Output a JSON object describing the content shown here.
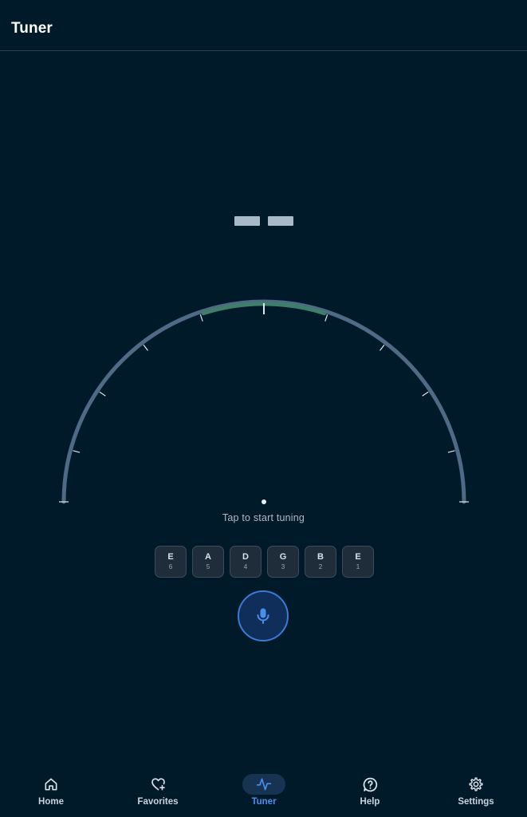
{
  "header": {
    "title": "Tuner"
  },
  "tuner": {
    "note_placeholder": "-- --",
    "status_text": "Tap to start tuning",
    "in_tune_color": "#3f7f6a",
    "arc_color": "#4e6a85",
    "needle_color": "#e8eef4"
  },
  "strings": [
    {
      "note": "E",
      "number": "6"
    },
    {
      "note": "A",
      "number": "5"
    },
    {
      "note": "D",
      "number": "4"
    },
    {
      "note": "G",
      "number": "3"
    },
    {
      "note": "B",
      "number": "2"
    },
    {
      "note": "E",
      "number": "1"
    }
  ],
  "mic_button": {
    "icon": "microphone-icon",
    "accent": "#3b7bd6"
  },
  "bottom_nav": {
    "active": "Tuner",
    "items": [
      {
        "label": "Home",
        "icon": "home-icon"
      },
      {
        "label": "Favorites",
        "icon": "heart-plus-icon"
      },
      {
        "label": "Tuner",
        "icon": "waveform-icon"
      },
      {
        "label": "Help",
        "icon": "help-icon"
      },
      {
        "label": "Settings",
        "icon": "gear-icon"
      }
    ]
  }
}
